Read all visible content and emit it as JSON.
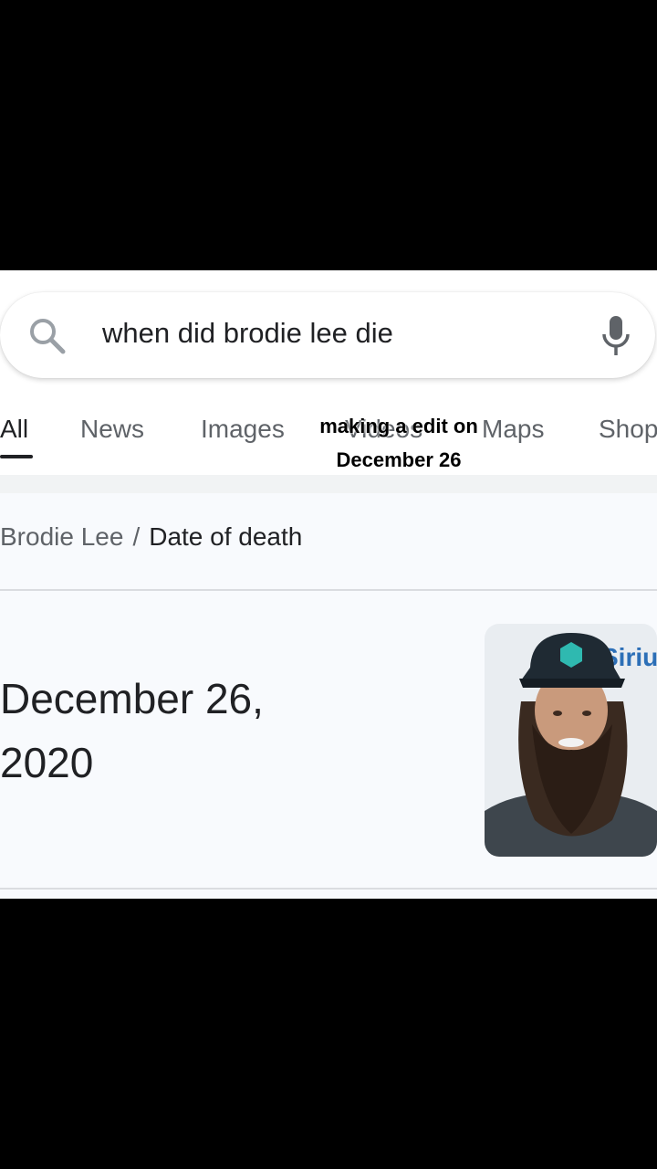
{
  "search": {
    "query": "when did brodie lee die",
    "icons": {
      "search": "search-icon",
      "mic": "microphone-icon"
    }
  },
  "tabs": [
    {
      "label": "All",
      "active": true
    },
    {
      "label": "News"
    },
    {
      "label": "Images"
    },
    {
      "label": "Videos"
    },
    {
      "label": "Maps"
    },
    {
      "label": "Shop"
    }
  ],
  "overlay": {
    "line1": "making a edit on",
    "line2": "December 26"
  },
  "answer_card": {
    "breadcrumb_entity": "Brodie Lee",
    "breadcrumb_separator": "/",
    "breadcrumb_attribute": "Date of death",
    "answer_line1": "December 26,",
    "answer_line2": "2020",
    "photo_banner_text": "Siriu"
  },
  "colors": {
    "accent": "#00a99d",
    "text_primary": "#202124",
    "text_secondary": "#5f6368",
    "card_background": "#f8fafd"
  }
}
